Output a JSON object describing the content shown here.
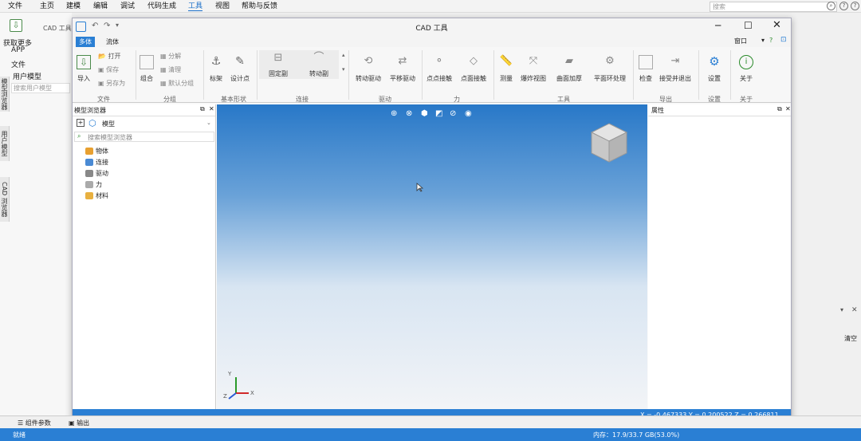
{
  "menubar": {
    "items": [
      "文件",
      "主页",
      "建模",
      "编辑",
      "调试",
      "代码生成",
      "工具",
      "视图",
      "帮助与反馈"
    ],
    "active": "工具",
    "search_placeholder": "搜索"
  },
  "bg_left": {
    "get_more": "获取更多",
    "app": "APP",
    "file": "文件",
    "user_model": "用户模型",
    "search_user_model": "搜索用户模型",
    "cad_tool": "CAD 工具",
    "vtab1": "模型浏览器",
    "vtab2": "用户模型",
    "vtab3": "CAD 浏览器"
  },
  "window": {
    "title": "CAD 工具",
    "tabs": [
      "多体",
      "流体"
    ],
    "window_menu": "窗口",
    "ribbon": {
      "file": {
        "import": "导入",
        "open": "打开",
        "save": "保存",
        "save_as": "另存为",
        "label": "文件"
      },
      "group": {
        "combine": "组合",
        "split": "分解",
        "clear": "清理",
        "default_group": "默认分组",
        "label": "分组"
      },
      "shape": {
        "frame": "标架",
        "design_point": "设计点",
        "label": "基本形状"
      },
      "connect": {
        "fixed": "固定副",
        "revolute": "转动副",
        "label": "连接"
      },
      "drive": {
        "rot": "转动驱动",
        "trans": "平移驱动",
        "label": "驱动"
      },
      "force": {
        "pp": "点点接触",
        "pf": "点面接触",
        "label": "力"
      },
      "tools": {
        "measure": "测量",
        "explode": "爆炸视图",
        "thicken": "曲面加厚",
        "ring": "平面环处理",
        "label": "工具"
      },
      "export": {
        "check": "检查",
        "accept": "接受并退出",
        "label": "导出"
      },
      "settings": {
        "btn": "设置",
        "label": "设置"
      },
      "about": {
        "btn": "关于",
        "label": "关于"
      }
    },
    "browser": {
      "title": "模型浏览器",
      "root": "模型",
      "search": "搜索模型浏览器",
      "items": [
        "物体",
        "连接",
        "驱动",
        "力",
        "材料"
      ]
    },
    "properties": {
      "title": "属性"
    },
    "status": {
      "coords": "X = -0.467333  Y = 0.200522  Z = 0.266811"
    }
  },
  "bottom": {
    "tab1": "组件参数",
    "tab2": "输出",
    "ready": "就绪",
    "memory": "内存：17.9/33.7 GB(53.0%)",
    "clear": "清空"
  },
  "axis": {
    "x": "X",
    "y": "Y",
    "z": "Z"
  }
}
